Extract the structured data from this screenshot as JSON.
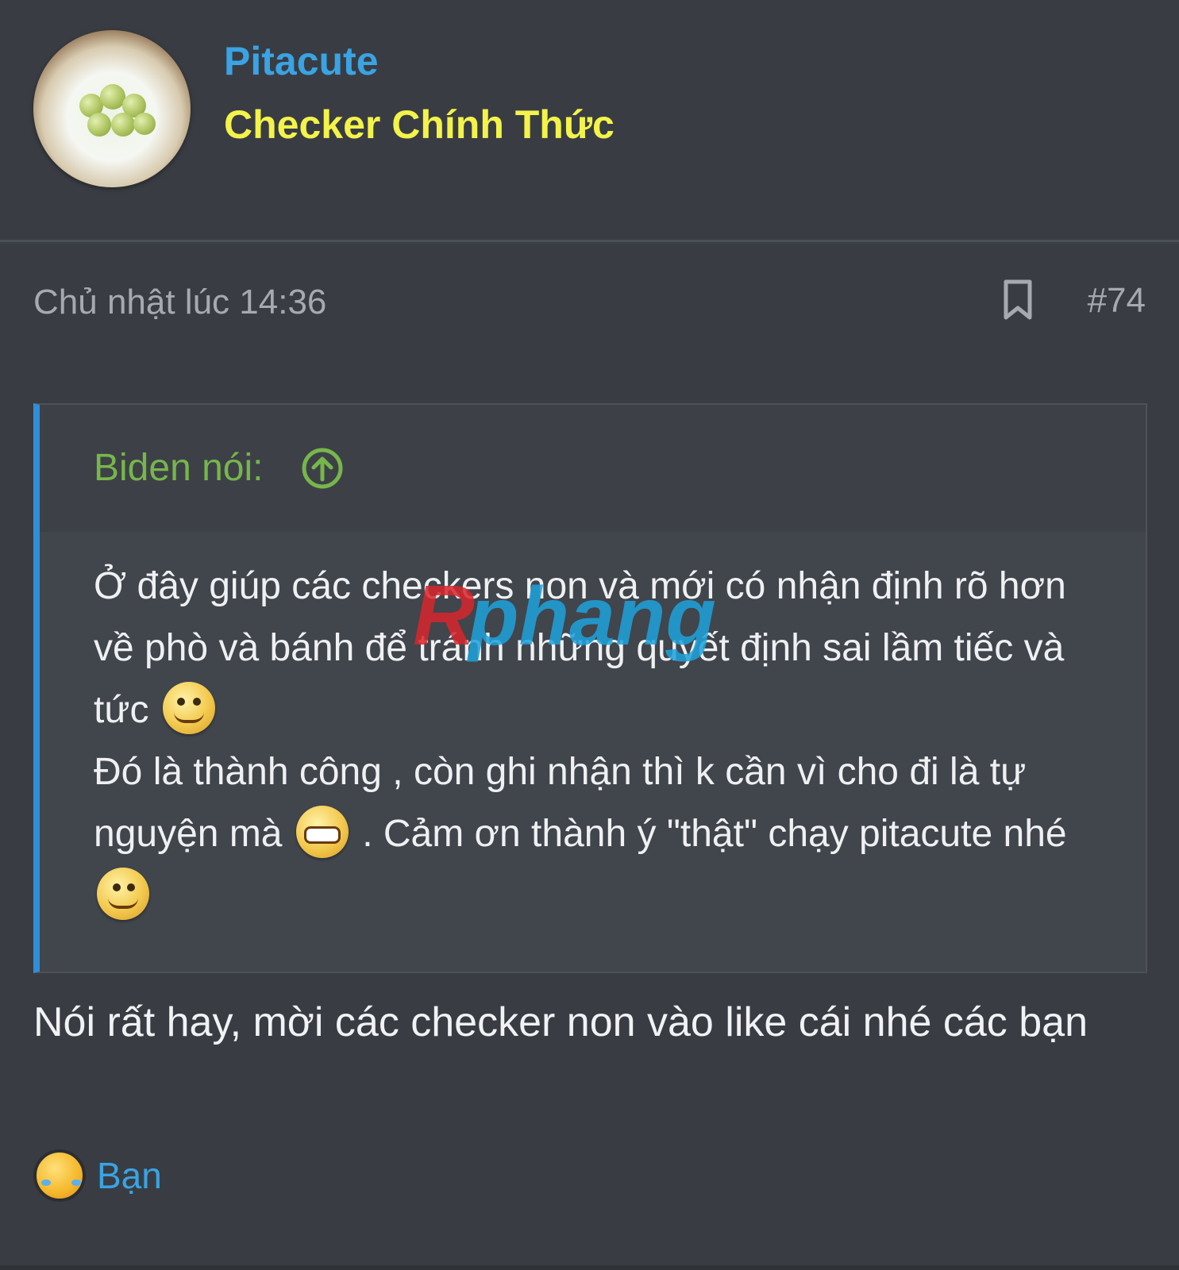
{
  "user": {
    "name": "Pitacute",
    "title": "Checker Chính Thức"
  },
  "post": {
    "time": "Chủ nhật lúc 14:36",
    "number": "#74",
    "quote": {
      "author": "Biden nói:",
      "line1": "Ở đây giúp các checkers non và mới có nhận định rõ hơn về phò và bánh để tránh những quyết định sai lầm tiếc và tức",
      "line2a": "Đó là thành công , còn ghi nhận thì k cần vì cho đi là tự nguyện mà",
      "line2b": ". Cảm ơn thành ý \"thật\" chạy pitacute nhé"
    },
    "reply": "Nói rất hay, mời các checker non vào like cái nhé các bạn",
    "reaction_label": "Bạn"
  },
  "watermark": "Rphang",
  "colors": {
    "username": "#3aa3e3",
    "title": "#f3f34a",
    "quote_author": "#77b64b",
    "quote_border": "#2f8fd6"
  }
}
